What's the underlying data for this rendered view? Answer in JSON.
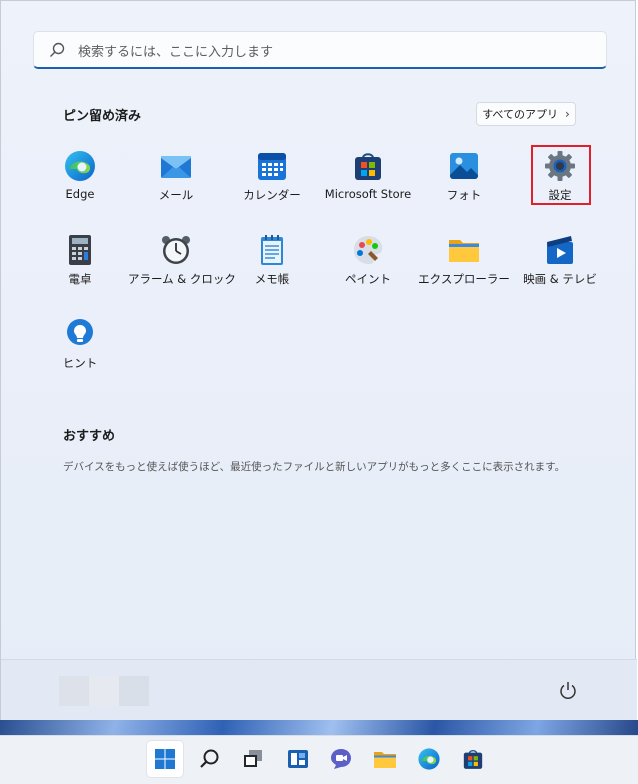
{
  "search": {
    "placeholder": "検索するには、ここに入力します"
  },
  "pinned": {
    "title": "ピン留め済み",
    "all_apps_label": "すべてのアプリ",
    "all_apps_chevron": "›",
    "apps": [
      {
        "label": "Edge",
        "icon": "edge-icon"
      },
      {
        "label": "メール",
        "icon": "mail-icon"
      },
      {
        "label": "カレンダー",
        "icon": "calendar-icon"
      },
      {
        "label": "Microsoft Store",
        "icon": "store-icon"
      },
      {
        "label": "フォト",
        "icon": "photos-icon"
      },
      {
        "label": "設定",
        "icon": "settings-gear-icon"
      },
      {
        "label": "電卓",
        "icon": "calculator-icon"
      },
      {
        "label": "アラーム & クロック",
        "icon": "alarm-clock-icon"
      },
      {
        "label": "メモ帳",
        "icon": "notepad-icon"
      },
      {
        "label": "ペイント",
        "icon": "paint-icon"
      },
      {
        "label": "エクスプローラー",
        "icon": "folder-icon"
      },
      {
        "label": "映画 & テレビ",
        "icon": "movies-tv-icon"
      },
      {
        "label": "ヒント",
        "icon": "tips-bulb-icon"
      }
    ]
  },
  "recommended": {
    "title": "おすすめ",
    "description": "デバイスをもっと使えば使うほど、最近使ったファイルと新しいアプリがもっと多くここに表示されます。"
  },
  "footer": {
    "power_icon": "power-icon"
  },
  "taskbar": {
    "items": [
      "start-icon",
      "search-icon",
      "task-view-icon",
      "widgets-icon",
      "chat-icon",
      "file-explorer-icon",
      "edge-icon",
      "store-icon"
    ]
  },
  "colors": {
    "accent": "#1a5fb4",
    "highlight": "#e0212c"
  }
}
